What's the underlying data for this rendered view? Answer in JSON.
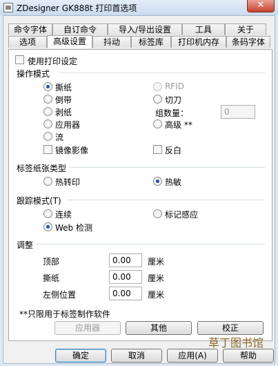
{
  "window": {
    "title": "ZDesigner GK888t 打印首选项",
    "close": "✕"
  },
  "tabs_back": [
    "命令字体",
    "自订命令",
    "导入/导出设置",
    "工具",
    "关于"
  ],
  "tabs_front": [
    "选项",
    "高级设置",
    "抖动",
    "标签库",
    "打印机内存",
    "条码字体"
  ],
  "active_tab": "高级设置",
  "use_printer_settings": {
    "label": "使用打印设定",
    "checked": false
  },
  "mode": {
    "title": "操作模式",
    "options": [
      "撕纸",
      "倒带",
      "剥纸",
      "应用器",
      "流",
      "RFID",
      "切刀",
      "高级 **"
    ],
    "selected": "撕纸",
    "disabled": "RFID",
    "group_count_label": "组数量：",
    "group_count_value": "0",
    "mirror": "镜像影像",
    "reverse": "反白"
  },
  "media_type": {
    "title": "标签纸张类型",
    "options": [
      "热转印",
      "热敏"
    ],
    "selected": "热敏"
  },
  "tracking": {
    "title": "跟踪模式(T)",
    "options": [
      "连续",
      "标记感应",
      "Web 检测"
    ],
    "selected": "Web 检测"
  },
  "adjust": {
    "title": "调整",
    "rows": [
      {
        "label": "顶部",
        "value": "0.00",
        "unit": "厘米"
      },
      {
        "label": "撕纸",
        "value": "0.00",
        "unit": "厘米"
      },
      {
        "label": "左侧位置",
        "value": "0.00",
        "unit": "厘米"
      }
    ]
  },
  "note": "**只限用于标签制作软件",
  "panel_buttons": [
    "应用器",
    "其他",
    "校正"
  ],
  "dialog_buttons": [
    "确定",
    "取消",
    "应用(A)",
    "帮助"
  ],
  "watermark": "草丁图书馆"
}
